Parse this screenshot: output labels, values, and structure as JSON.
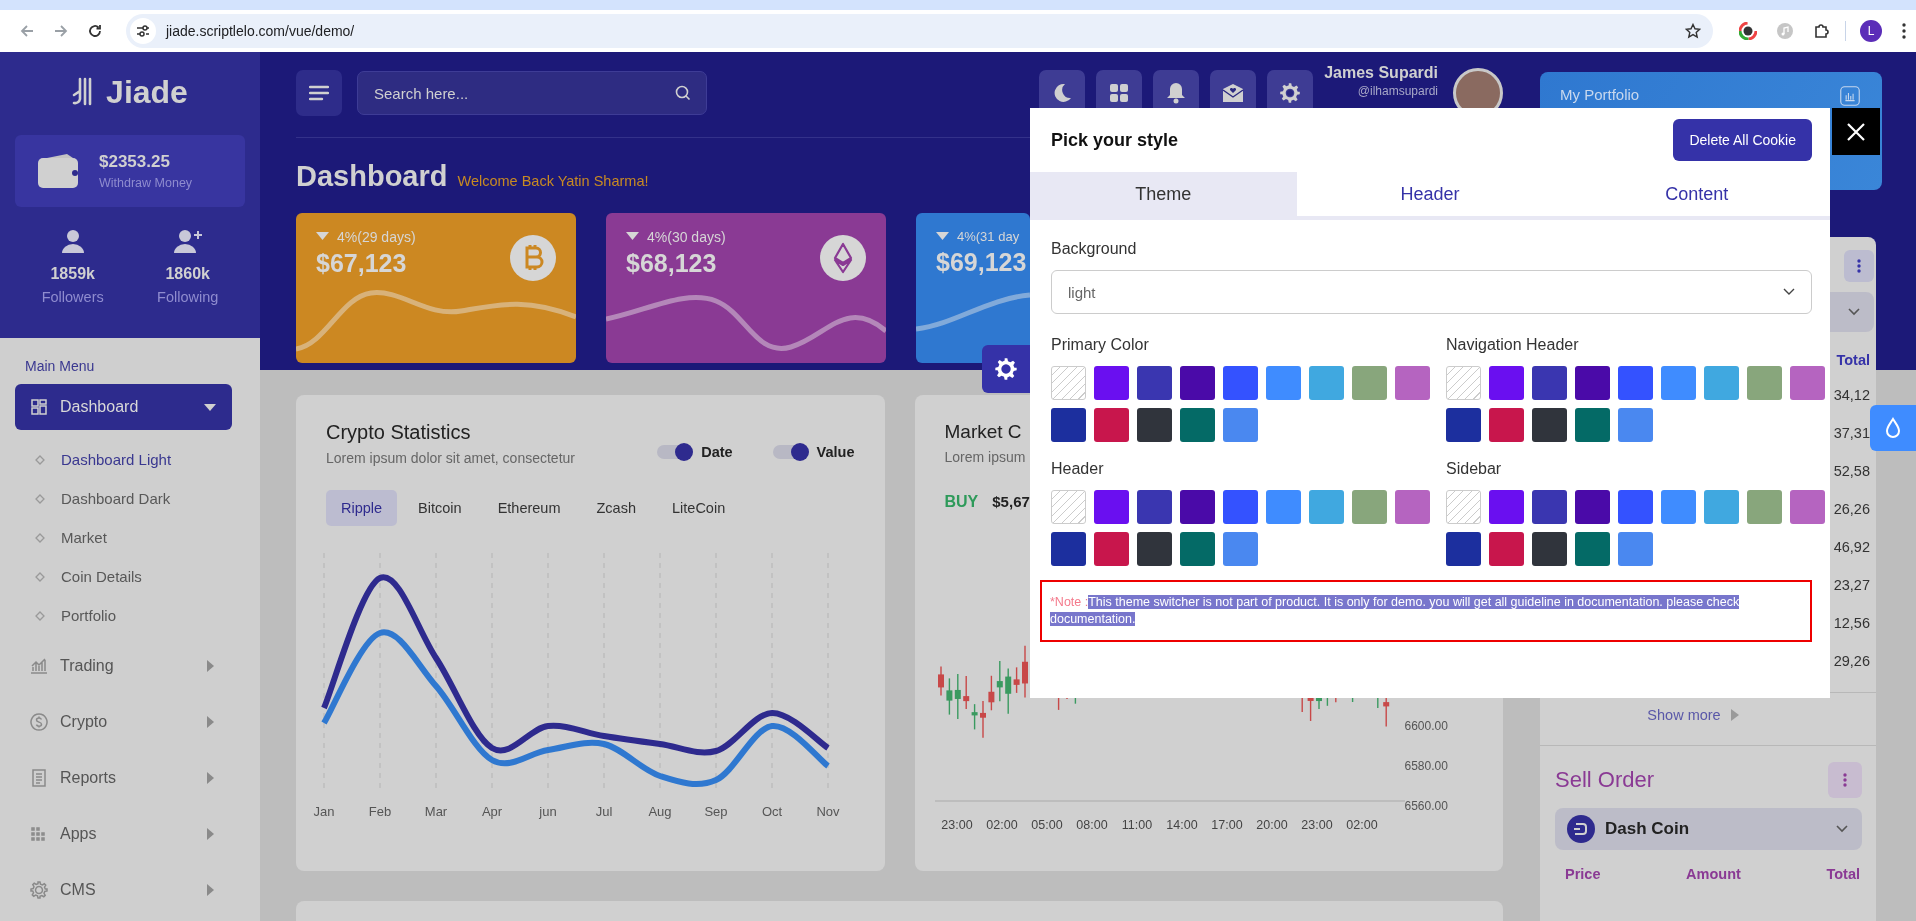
{
  "browser": {
    "url": "jiade.scriptlelo.com/vue/demo/",
    "profile_initial": "L"
  },
  "sidebar": {
    "logo": "Jiade",
    "wallet": {
      "amount": "$2353.25",
      "label": "Withdraw Money"
    },
    "stats": [
      {
        "value": "1859k",
        "label": "Followers"
      },
      {
        "value": "1860k",
        "label": "Following"
      }
    ],
    "menu_title": "Main Menu",
    "menu": [
      {
        "label": "Dashboard",
        "selected": true,
        "expanded": true,
        "children": [
          {
            "label": "Dashboard Light",
            "selected": true
          },
          {
            "label": "Dashboard Dark",
            "selected": false
          },
          {
            "label": "Market",
            "selected": false
          },
          {
            "label": "Coin Details",
            "selected": false
          },
          {
            "label": "Portfolio",
            "selected": false
          }
        ]
      },
      {
        "label": "Trading",
        "selected": false,
        "expanded": false
      },
      {
        "label": "Crypto",
        "selected": false,
        "expanded": false
      },
      {
        "label": "Reports",
        "selected": false,
        "expanded": false
      },
      {
        "label": "Apps",
        "selected": false,
        "expanded": false
      },
      {
        "label": "CMS",
        "selected": false,
        "expanded": false
      }
    ]
  },
  "header": {
    "search_placeholder": "Search here...",
    "user": {
      "name": "James Supardi",
      "handle": "@ilhamsupardi"
    }
  },
  "page": {
    "title": "Dashboard",
    "welcome": "Welcome Back Yatin Sharma!"
  },
  "stat_cards": [
    {
      "color": "#cc8822",
      "change": "4%(29 days)",
      "value": "$67,123"
    },
    {
      "color": "#8a3a94",
      "change": "4%(30 days)",
      "value": "$68,123"
    },
    {
      "color": "#2f78d0",
      "change": "4%(31 day",
      "value": "$69,123"
    }
  ],
  "crypto_statistics": {
    "title": "Crypto Statistics",
    "subtitle": "Lorem ipsum dolor sit amet, consectetur",
    "toggles": [
      {
        "label": "Date",
        "on": true
      },
      {
        "label": "Value",
        "on": true
      }
    ],
    "tabs": [
      {
        "label": "Ripple",
        "selected": true
      },
      {
        "label": "Bitcoin",
        "selected": false
      },
      {
        "label": "Ethereum",
        "selected": false
      },
      {
        "label": "Zcash",
        "selected": false
      },
      {
        "label": "LiteCoin",
        "selected": false
      }
    ],
    "months": [
      "Jan",
      "Feb",
      "Mar",
      "Apr",
      "jun",
      "Jul",
      "Aug",
      "Sep",
      "Oct",
      "Nov"
    ]
  },
  "market": {
    "title": "Market C",
    "subtitle": "Lorem ipsum",
    "side": "BUY",
    "price": "$5,67",
    "y_labels": [
      "6600.00",
      "6580.00",
      "6560.00"
    ],
    "x_labels": [
      "23:00",
      "02:00",
      "05:00",
      "08:00",
      "11:00",
      "14:00",
      "17:00",
      "20:00",
      "23:00",
      "02:00"
    ]
  },
  "portfolio": {
    "title": "My Portfolio"
  },
  "order_book": {
    "total_header": "Total",
    "totals": [
      "34,12",
      "37,31",
      "52,58",
      "26,26",
      "46,92",
      "23,27",
      "12,56",
      "29,26"
    ],
    "show_more": "Show more"
  },
  "sell_order": {
    "title": "Sell Order",
    "coin": "Dash Coin",
    "columns": [
      "Price",
      "Amount",
      "Total"
    ]
  },
  "style_picker": {
    "title": "Pick your style",
    "delete_button": "Delete All Cookie",
    "tabs": [
      {
        "label": "Theme",
        "selected": true
      },
      {
        "label": "Header",
        "selected": false
      },
      {
        "label": "Content",
        "selected": false
      }
    ],
    "background": {
      "label": "Background",
      "value": "light"
    },
    "palettes": [
      {
        "label": "Primary Color",
        "swatches": [
          {
            "kind": "none"
          },
          {
            "kind": "color",
            "color": "#6a0ff0"
          },
          {
            "kind": "color",
            "color": "#3a36b0"
          },
          {
            "kind": "color",
            "color": "#4a0aa8"
          },
          {
            "kind": "color",
            "color": "#3452ff"
          },
          {
            "kind": "color",
            "color": "#3f8cff"
          },
          {
            "kind": "color",
            "color": "#40a8e0"
          },
          {
            "kind": "color",
            "color": "#88a67c"
          },
          {
            "kind": "color",
            "color": "#b564c0"
          },
          {
            "kind": "color",
            "color": "#1c2f9e"
          },
          {
            "kind": "color",
            "color": "#c8164c"
          },
          {
            "kind": "color",
            "color": "#30343c"
          },
          {
            "kind": "color",
            "color": "#046a66"
          },
          {
            "kind": "color",
            "color": "#4a88f0"
          }
        ]
      },
      {
        "label": "Navigation Header",
        "swatches": [
          {
            "kind": "none"
          },
          {
            "kind": "color",
            "color": "#6a0ff0"
          },
          {
            "kind": "color",
            "color": "#3a36b0"
          },
          {
            "kind": "color",
            "color": "#4a0aa8"
          },
          {
            "kind": "color",
            "color": "#3452ff"
          },
          {
            "kind": "color",
            "color": "#3f8cff"
          },
          {
            "kind": "color",
            "color": "#40a8e0"
          },
          {
            "kind": "color",
            "color": "#88a67c"
          },
          {
            "kind": "color",
            "color": "#b564c0"
          },
          {
            "kind": "color",
            "color": "#1c2f9e"
          },
          {
            "kind": "color",
            "color": "#c8164c"
          },
          {
            "kind": "color",
            "color": "#30343c"
          },
          {
            "kind": "color",
            "color": "#046a66"
          },
          {
            "kind": "color",
            "color": "#4a88f0"
          }
        ]
      },
      {
        "label": "Header",
        "swatches": [
          {
            "kind": "none"
          },
          {
            "kind": "color",
            "color": "#6a0ff0"
          },
          {
            "kind": "color",
            "color": "#3a36b0"
          },
          {
            "kind": "color",
            "color": "#4a0aa8"
          },
          {
            "kind": "color",
            "color": "#3452ff"
          },
          {
            "kind": "color",
            "color": "#3f8cff"
          },
          {
            "kind": "color",
            "color": "#40a8e0"
          },
          {
            "kind": "color",
            "color": "#88a67c"
          },
          {
            "kind": "color",
            "color": "#b564c0"
          },
          {
            "kind": "color",
            "color": "#1c2f9e"
          },
          {
            "kind": "color",
            "color": "#c8164c"
          },
          {
            "kind": "color",
            "color": "#30343c"
          },
          {
            "kind": "color",
            "color": "#046a66"
          },
          {
            "kind": "color",
            "color": "#4a88f0"
          }
        ]
      },
      {
        "label": "Sidebar",
        "swatches": [
          {
            "kind": "none"
          },
          {
            "kind": "color",
            "color": "#6a0ff0"
          },
          {
            "kind": "color",
            "color": "#3a36b0"
          },
          {
            "kind": "color",
            "color": "#4a0aa8"
          },
          {
            "kind": "color",
            "color": "#3452ff"
          },
          {
            "kind": "color",
            "color": "#3f8cff"
          },
          {
            "kind": "color",
            "color": "#40a8e0"
          },
          {
            "kind": "color",
            "color": "#88a67c"
          },
          {
            "kind": "color",
            "color": "#b564c0"
          },
          {
            "kind": "color",
            "color": "#1c2f9e"
          },
          {
            "kind": "color",
            "color": "#c8164c"
          },
          {
            "kind": "color",
            "color": "#30343c"
          },
          {
            "kind": "color",
            "color": "#046a66"
          },
          {
            "kind": "color",
            "color": "#4a88f0"
          }
        ]
      }
    ],
    "note": {
      "prefix": "*Note :",
      "text": "This theme switcher is not part of product. It is only for demo. you will get all guideline in documentation. please check documentation.",
      "highlighted": true
    }
  }
}
